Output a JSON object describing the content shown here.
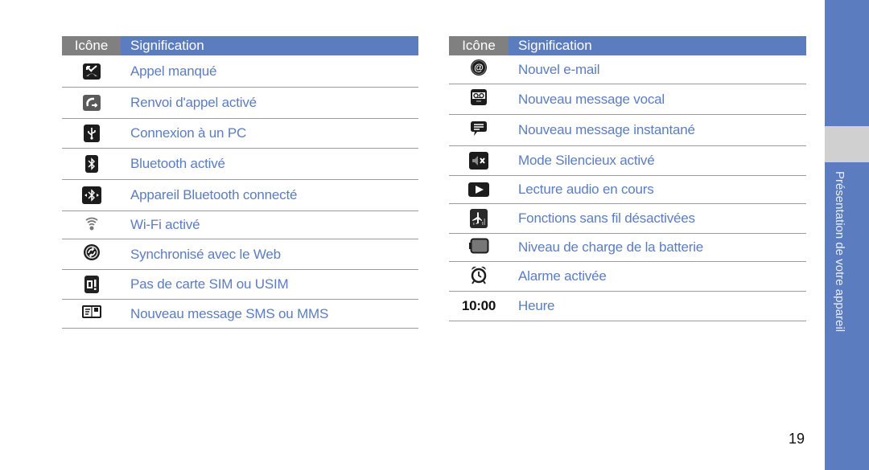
{
  "tables": [
    {
      "header": {
        "icon": "Icône",
        "meaning": "Signification"
      },
      "rows": [
        {
          "icon": "missed-call-icon",
          "text": "Appel manqué"
        },
        {
          "icon": "call-forward-icon",
          "text": "Renvoi d'appel activé"
        },
        {
          "icon": "usb-icon",
          "text": "Connexion à un PC"
        },
        {
          "icon": "bluetooth-icon",
          "text": "Bluetooth activé"
        },
        {
          "icon": "bluetooth-connected-icon",
          "text": "Appareil Bluetooth connecté"
        },
        {
          "icon": "wifi-icon",
          "text": "Wi-Fi activé"
        },
        {
          "icon": "sync-icon",
          "text": "Synchronisé avec le Web"
        },
        {
          "icon": "no-sim-icon",
          "text": "Pas de carte SIM ou USIM"
        },
        {
          "icon": "sms-icon",
          "text": "Nouveau message SMS ou MMS"
        }
      ]
    },
    {
      "header": {
        "icon": "Icône",
        "meaning": "Signification"
      },
      "rows": [
        {
          "icon": "email-icon",
          "text": "Nouvel e-mail"
        },
        {
          "icon": "voicemail-icon",
          "text": "Nouveau message vocal"
        },
        {
          "icon": "instant-message-icon",
          "text": "Nouveau message instantané"
        },
        {
          "icon": "silent-mode-icon",
          "text": "Mode Silencieux activé"
        },
        {
          "icon": "play-icon",
          "text": "Lecture audio en cours"
        },
        {
          "icon": "airplane-mode-icon",
          "text": "Fonctions sans fil désactivées"
        },
        {
          "icon": "battery-icon",
          "text": "Niveau de charge de la batterie"
        },
        {
          "icon": "alarm-icon",
          "text": "Alarme activée"
        },
        {
          "icon": "time-display",
          "text": "Heure",
          "icon_text": "10:00"
        }
      ]
    }
  ],
  "sidebar": {
    "label": "Présentation de votre appareil"
  },
  "page_number": "19",
  "colors": {
    "accent": "#5b7dbf",
    "header_gray": "#808080",
    "tab_gray": "#d0d0d0"
  }
}
